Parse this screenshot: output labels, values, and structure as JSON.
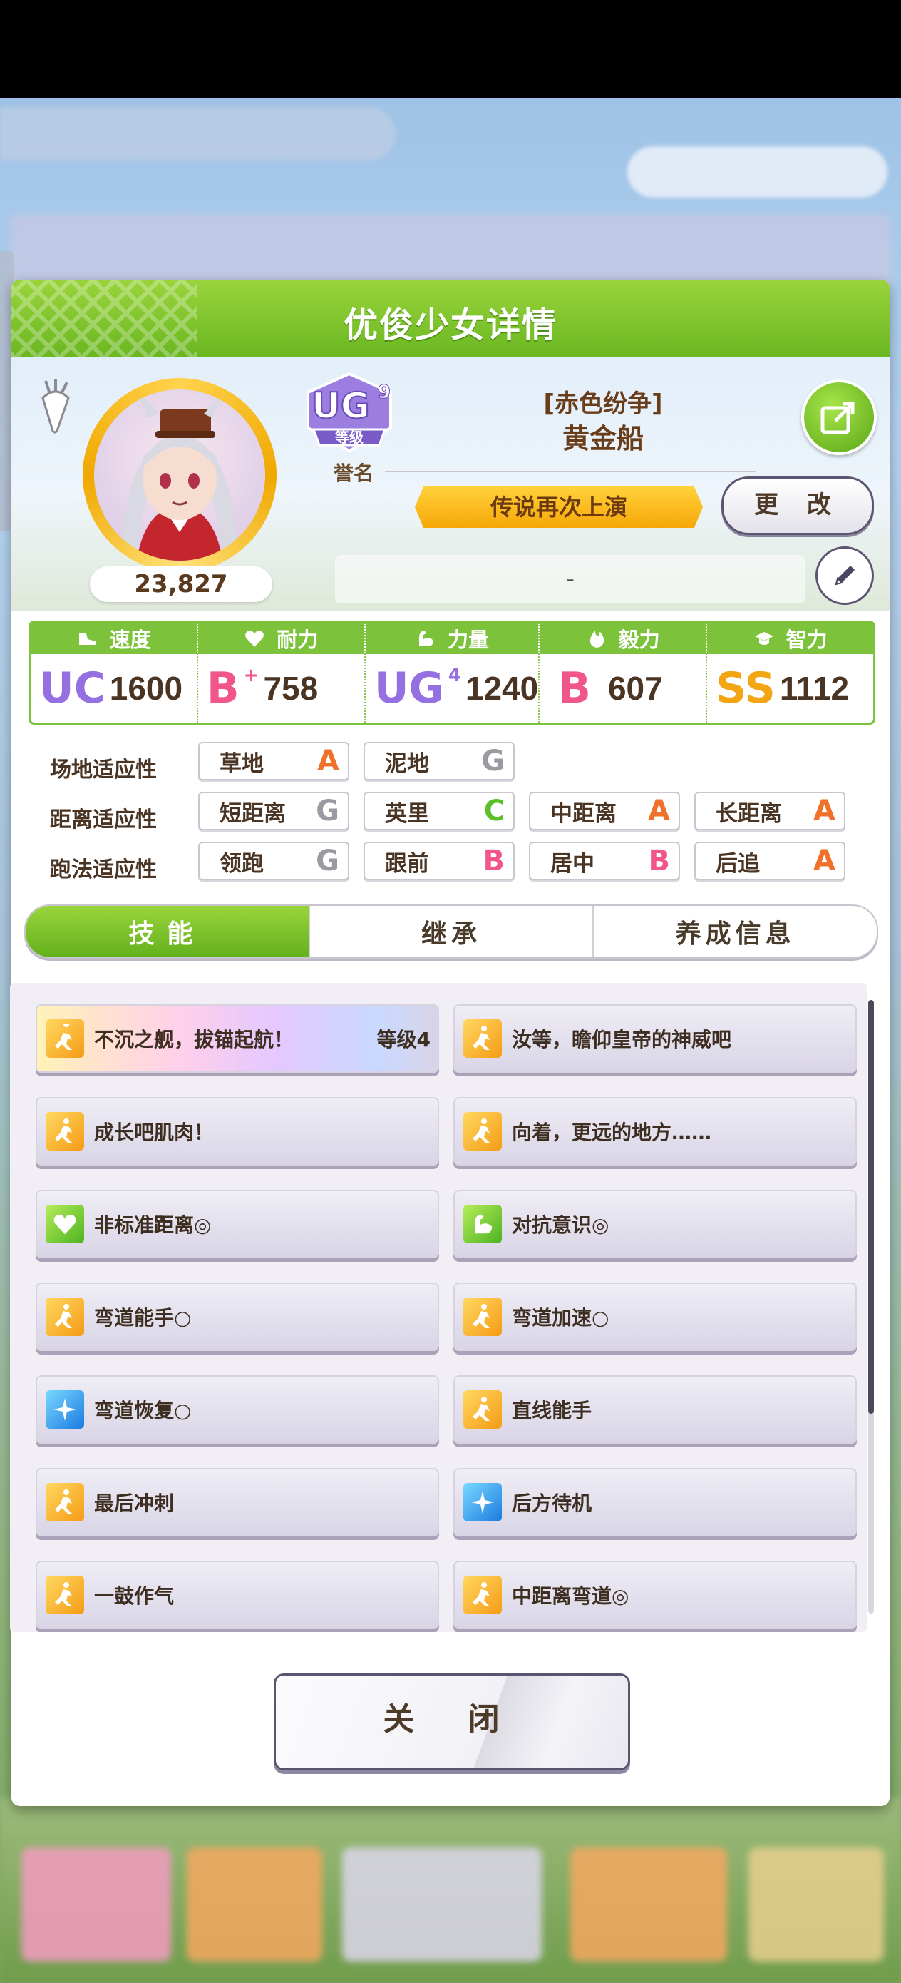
{
  "dialog": {
    "title": "优俊少女详情"
  },
  "profile": {
    "score": "23,827",
    "grade": {
      "rank": "UG",
      "sub_rank": "9",
      "badge_text": "等级",
      "label": "誉名"
    },
    "title_sub": "[赤色纷争]",
    "name": "黄金船",
    "epithet": "传说再次上演",
    "change_label": "更 改",
    "comment": "-"
  },
  "stats": [
    {
      "label": "速度",
      "icon": "shoe-icon",
      "rank": "UC",
      "rank_sup": "",
      "value": "1600"
    },
    {
      "label": "耐力",
      "icon": "heart-icon",
      "rank": "B",
      "rank_sup": "+",
      "value": "758"
    },
    {
      "label": "力量",
      "icon": "muscle-icon",
      "rank": "UG",
      "rank_sup": "4",
      "value": "1240"
    },
    {
      "label": "毅力",
      "icon": "flame-icon",
      "rank": "B",
      "rank_sup": "",
      "value": "607"
    },
    {
      "label": "智力",
      "icon": "graduation-cap-icon",
      "rank": "SS",
      "rank_sup": "",
      "value": "1112"
    }
  ],
  "aptitudes": {
    "field": {
      "label": "场地适应性",
      "items": [
        {
          "name": "草地",
          "grade": "A"
        },
        {
          "name": "泥地",
          "grade": "G"
        }
      ]
    },
    "distance": {
      "label": "距离适应性",
      "items": [
        {
          "name": "短距离",
          "grade": "G"
        },
        {
          "name": "英里",
          "grade": "C"
        },
        {
          "name": "中距离",
          "grade": "A"
        },
        {
          "name": "长距离",
          "grade": "A"
        }
      ]
    },
    "style": {
      "label": "跑法适应性",
      "items": [
        {
          "name": "领跑",
          "grade": "G"
        },
        {
          "name": "跟前",
          "grade": "B"
        },
        {
          "name": "居中",
          "grade": "B"
        },
        {
          "name": "后追",
          "grade": "A"
        }
      ]
    }
  },
  "tabs": [
    {
      "label": "技能"
    },
    {
      "label": "继承"
    },
    {
      "label": "养成信息"
    }
  ],
  "skills": [
    {
      "name": "不沉之舰，拔锚起航！",
      "level": "等级4",
      "icon": "gold"
    },
    {
      "name": "汝等，瞻仰皇帝的神威吧",
      "icon": "gold"
    },
    {
      "name": "成长吧肌肉！",
      "icon": "gold"
    },
    {
      "name": "向着，更远的地方……",
      "icon": "gold"
    },
    {
      "name": "非标准距离◎",
      "icon": "green"
    },
    {
      "name": "对抗意识◎",
      "icon": "green"
    },
    {
      "name": "弯道能手○",
      "icon": "gold"
    },
    {
      "name": "弯道加速○",
      "icon": "gold"
    },
    {
      "name": "弯道恢复○",
      "icon": "blue"
    },
    {
      "name": "直线能手",
      "icon": "gold"
    },
    {
      "name": "最后冲刺",
      "icon": "gold"
    },
    {
      "name": "后方待机",
      "icon": "blue"
    },
    {
      "name": "一鼓作气",
      "icon": "gold"
    },
    {
      "name": "中距离弯道◎",
      "icon": "gold"
    }
  ],
  "close_label": "关 闭",
  "colors": {
    "accent_green": "#7cc23a",
    "grade_A": "#f0712a",
    "grade_B": "#f0568c",
    "grade_C": "#5bc02a",
    "grade_G": "#9a9aa2"
  }
}
